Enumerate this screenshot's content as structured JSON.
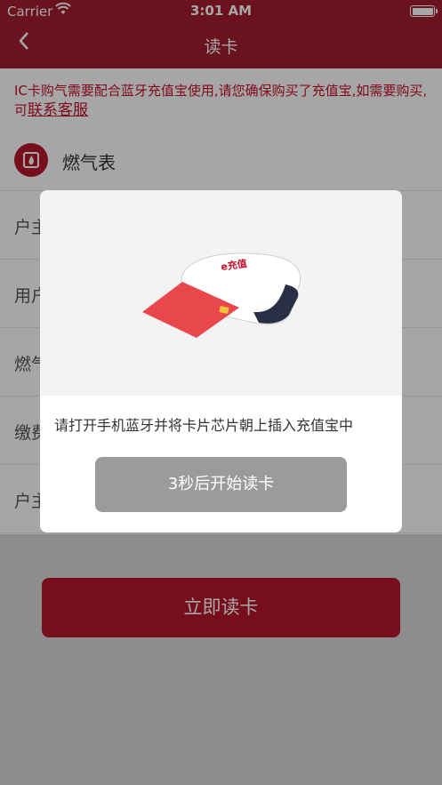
{
  "status_bar": {
    "carrier": "Carrier",
    "time": "3:01 AM",
    "wifi_icon": "wifi-icon",
    "battery_icon": "battery-icon"
  },
  "nav": {
    "back_icon": "chevron-left-icon",
    "back_glyph": "〈",
    "title": "读卡"
  },
  "notice": {
    "text": "IC卡购气需要配合蓝牙充值宝使用,请您确保购买了充值宝,如需要购买,可",
    "link": "联系客服"
  },
  "meter": {
    "icon": "flame-icon",
    "icon_glyph": "🔥",
    "title": "燃气表",
    "rows": [
      {
        "label": "户主"
      },
      {
        "label": "用户"
      },
      {
        "label": "燃气"
      },
      {
        "label": "缴费"
      },
      {
        "label": "户主"
      }
    ]
  },
  "primary_button": {
    "label": "立即读卡"
  },
  "modal": {
    "instruction": "请打开手机蓝牙并将卡片芯片朝上插入充值宝中",
    "countdown_label": "3秒后开始读卡",
    "device_logo": "e充值"
  },
  "colors": {
    "brand_red": "#a41d2d",
    "button_red": "#b5172a",
    "notice_red": "#c4102b",
    "countdown_gray": "#9b9b9b"
  }
}
